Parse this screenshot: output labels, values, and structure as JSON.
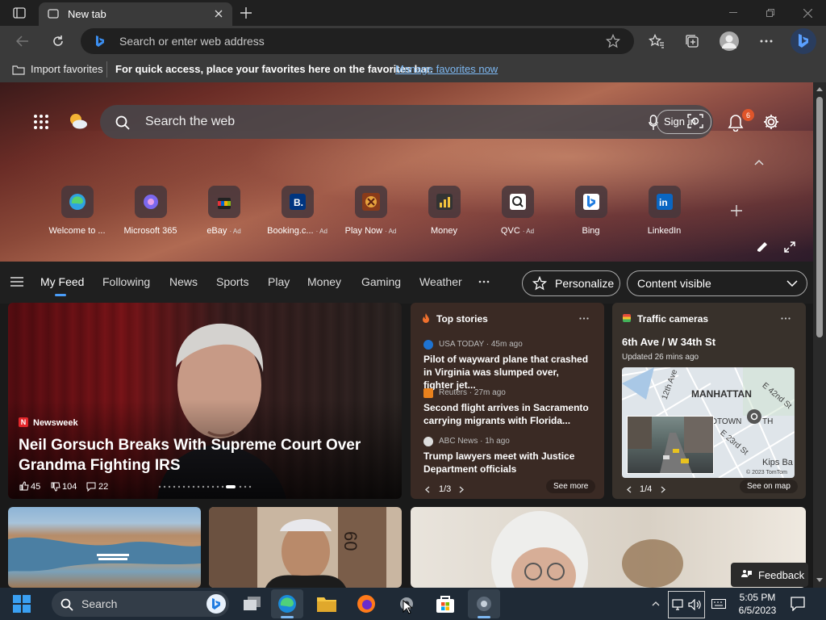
{
  "browser": {
    "tab_title": "New tab",
    "address_placeholder": "Search or enter web address",
    "favorites_bar": {
      "import_label": "Import favorites",
      "message": "For quick access, place your favorites here on the favorites bar.",
      "link": "Manage favorites now"
    }
  },
  "newtab": {
    "search_placeholder": "Search the web",
    "sign_in": "Sign in",
    "notification_count": "6",
    "quick_links": [
      {
        "label": "Welcome to ...",
        "ad": ""
      },
      {
        "label": "Microsoft 365",
        "ad": ""
      },
      {
        "label": "eBay",
        "ad": "· Ad"
      },
      {
        "label": "Booking.c...",
        "ad": "· Ad"
      },
      {
        "label": "Play Now",
        "ad": "· Ad"
      },
      {
        "label": "Money",
        "ad": ""
      },
      {
        "label": "QVC",
        "ad": "· Ad"
      },
      {
        "label": "Bing",
        "ad": ""
      },
      {
        "label": "LinkedIn",
        "ad": ""
      }
    ],
    "feed_tabs": [
      "My Feed",
      "Following",
      "News",
      "Sports",
      "Play",
      "Money",
      "Gaming",
      "Weather"
    ],
    "personalize": "Personalize",
    "content_visibility": "Content visible"
  },
  "hero_story": {
    "source": "Newsweek",
    "headline": "Neil Gorsuch Breaks With Supreme Court Over Grandma Fighting IRS",
    "likes": "45",
    "dislikes": "104",
    "comments": "22"
  },
  "top_stories": {
    "title": "Top stories",
    "items": [
      {
        "source": "USA TODAY · 45m ago",
        "headline": "Pilot of wayward plane that crashed in Virginia was slumped over, fighter jet..."
      },
      {
        "source": "Reuters · 27m ago",
        "headline": "Second flight arrives in Sacramento carrying migrants with Florida..."
      },
      {
        "source": "ABC News · 1h ago",
        "headline": "Trump lawyers meet with Justice Department officials"
      }
    ],
    "pager": "1/3",
    "see_more": "See more"
  },
  "traffic": {
    "title": "Traffic cameras",
    "location": "6th Ave / W 34th St",
    "updated": "Updated 26 mins ago",
    "map_labels": [
      "MANHATTAN",
      "12th Ave",
      "E 42nd St",
      "IDTOWN",
      "TH",
      "E 23rd St",
      "Kips Ba",
      "© 2023 TomTom"
    ],
    "pager": "1/4",
    "see_on_map": "See on map"
  },
  "feedback": "Feedback",
  "taskbar": {
    "search_label": "Search",
    "time": "5:05 PM",
    "date": "6/5/2023"
  },
  "colors": {
    "accent": "#4a9df8",
    "link": "#7db8f2",
    "badge": "#e0552a"
  }
}
